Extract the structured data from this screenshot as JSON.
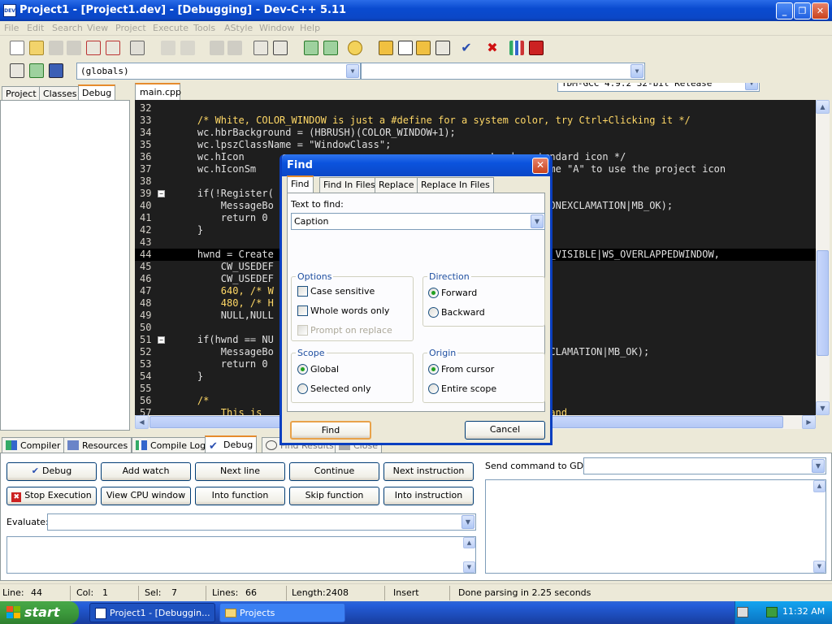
{
  "window": {
    "title": "Project1 - [Project1.dev] - [Debugging] - Dev-C++ 5.11",
    "app_icon": "DEV"
  },
  "menu": [
    "File",
    "Edit",
    "Search",
    "View",
    "Project",
    "Execute",
    "Tools",
    "AStyle",
    "Window",
    "Help"
  ],
  "toolbar": {
    "compiler": "TDM-GCC 4.9.2 32-bit Release",
    "scope": "(globals)",
    "members": ""
  },
  "project_tabs": [
    "Project",
    "Classes",
    "Debug"
  ],
  "editor": {
    "tab": "main.cpp",
    "lines": [
      {
        "n": "32",
        "code": ""
      },
      {
        "n": "33",
        "code": "    /* White, COLOR_WINDOW is just a #define for a system color, try Ctrl+Clicking it */"
      },
      {
        "n": "34",
        "code": "    wc.hbrBackground = (HBRUSH)(COLOR_WINDOW+1);"
      },
      {
        "n": "35",
        "code": "    wc.lpszClassName = \"WindowClass\";"
      },
      {
        "n": "36",
        "code": "    wc.hIcon                                          Load a standard icon */"
      },
      {
        "n": "37",
        "code": "    wc.hIconSm                                        use the name \"A\" to use the project icon"
      },
      {
        "n": "38",
        "code": ""
      },
      {
        "n": "39",
        "code": "    if(!Register("
      },
      {
        "n": "40",
        "code": "        MessageBo                                    ror!\",MB_ICONEXCLAMATION|MB_OK);"
      },
      {
        "n": "41",
        "code": "        return 0"
      },
      {
        "n": "42",
        "code": "    }"
      },
      {
        "n": "43",
        "code": ""
      },
      {
        "n": "44",
        "code": "    hwnd = Create                                    Caption\",WS_VISIBLE|WS_OVERLAPPEDWINDOW,"
      },
      {
        "n": "45",
        "code": "        CW_USEDEF"
      },
      {
        "n": "46",
        "code": "        CW_USEDEF"
      },
      {
        "n": "47",
        "code": "        640, /* W"
      },
      {
        "n": "48",
        "code": "        480, /* H"
      },
      {
        "n": "49",
        "code": "        NULL,NULL"
      },
      {
        "n": "50",
        "code": ""
      },
      {
        "n": "51",
        "code": "    if(hwnd == NU"
      },
      {
        "n": "52",
        "code": "        MessageBo                                    ',MB_ICONEXCLAMATION|MB_OK);"
      },
      {
        "n": "53",
        "code": "        return 0"
      },
      {
        "n": "54",
        "code": "    }"
      },
      {
        "n": "55",
        "code": ""
      },
      {
        "n": "56",
        "code": "    /*"
      },
      {
        "n": "57",
        "code": "        This is                                     s processed and"
      }
    ]
  },
  "bottom_tabs": [
    "Compiler",
    "Resources",
    "Compile Log",
    "Debug",
    "Find Results",
    "Close"
  ],
  "debug_buttons": [
    "Debug",
    "Add watch",
    "Next line",
    "Continue",
    "Next instruction",
    "Stop Execution",
    "View CPU window",
    "Into function",
    "Skip function",
    "Into instruction"
  ],
  "evaluate_label": "Evaluate:",
  "gdb_label": "Send command to GDB:",
  "status": {
    "line_label": "Line:",
    "line": "44",
    "col_label": "Col:",
    "col": "1",
    "sel_label": "Sel:",
    "sel": "7",
    "lines_label": "Lines:",
    "lines": "66",
    "length_label": "Length:",
    "length": "2408",
    "mode": "Insert",
    "message": "Done parsing in 2.25 seconds"
  },
  "find": {
    "title": "Find",
    "tabs": [
      "Find",
      "Find In Files",
      "Replace",
      "Replace In Files"
    ],
    "text_label": "Text to find:",
    "text_value": "Caption",
    "options_label": "Options",
    "case_sensitive": "Case sensitive",
    "whole_words": "Whole words only",
    "prompt_replace": "Prompt on replace",
    "direction_label": "Direction",
    "forward": "Forward",
    "backward": "Backward",
    "scope_label": "Scope",
    "global": "Global",
    "selected_only": "Selected only",
    "origin_label": "Origin",
    "from_cursor": "From cursor",
    "entire_scope": "Entire scope",
    "find_button": "Find",
    "cancel_button": "Cancel"
  },
  "taskbar": {
    "start": "start",
    "tasks": [
      "Project1 - [Debuggin...",
      "Projects"
    ],
    "clock": "11:32 AM"
  },
  "colors": {
    "titlebar": "#0a4bd0",
    "editor_bg": "#1e1e1e",
    "comment": "#ffd866",
    "highlight": "#000000",
    "tab_accent": "#e68b2c"
  }
}
